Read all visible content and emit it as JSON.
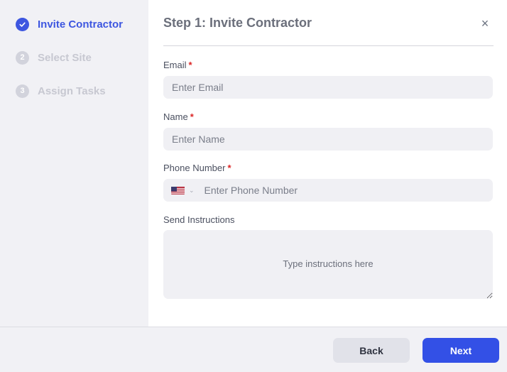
{
  "steps": [
    {
      "number": "✓",
      "label": "Invite Contractor",
      "state": "done"
    },
    {
      "number": "2",
      "label": "Select Site",
      "state": "todo"
    },
    {
      "number": "3",
      "label": "Assign Tasks",
      "state": "todo"
    }
  ],
  "header": {
    "title": "Step 1: Invite Contractor",
    "close_glyph": "×"
  },
  "form": {
    "email": {
      "label": "Email",
      "required": "*",
      "placeholder": "Enter Email"
    },
    "name": {
      "label": "Name",
      "required": "*",
      "placeholder": "Enter Name"
    },
    "phone": {
      "label": "Phone Number",
      "required": "*",
      "placeholder": "Enter Phone Number",
      "country_icon": "us-flag-icon",
      "chevron": "⌄"
    },
    "instructions": {
      "label": "Send Instructions",
      "placeholder": "Type instructions here"
    }
  },
  "footer": {
    "back_label": "Back",
    "next_label": "Next"
  },
  "colors": {
    "accent": "#3d56e0",
    "next_button": "#3350e6",
    "required": "#dc2626"
  }
}
